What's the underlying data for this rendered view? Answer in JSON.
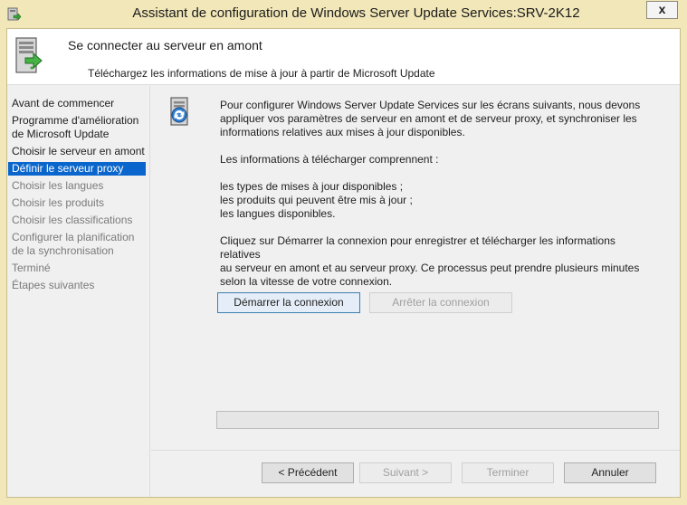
{
  "window": {
    "title": "Assistant de configuration de Windows Server Update Services:SRV-2K12",
    "close_label": "x"
  },
  "header": {
    "title": "Se connecter au serveur en amont",
    "subtitle": "Téléchargez les informations de mise à jour à partir de Microsoft Update"
  },
  "sidebar": {
    "items": [
      {
        "label": "Avant de commencer",
        "state": "normal"
      },
      {
        "label": "Programme d'amélioration de Microsoft Update",
        "state": "normal"
      },
      {
        "label": "Choisir le serveur en amont",
        "state": "normal"
      },
      {
        "label": "Définir le serveur proxy",
        "state": "active"
      },
      {
        "label": "Choisir les langues",
        "state": "muted"
      },
      {
        "label": "Choisir les produits",
        "state": "muted"
      },
      {
        "label": "Choisir les classifications",
        "state": "muted"
      },
      {
        "label": "Configurer la planification de la synchronisation",
        "state": "muted"
      },
      {
        "label": "Terminé",
        "state": "muted"
      },
      {
        "label": "Étapes suivantes",
        "state": "muted"
      }
    ]
  },
  "content": {
    "intro_line1": "Pour configurer Windows Server Update Services sur les écrans suivants, nous devons",
    "intro_line2": "appliquer vos paramètres de serveur en amont et de serveur proxy, et synchroniser les",
    "intro_line3": "informations relatives aux mises à jour disponibles.",
    "download_heading": "Les informations à télécharger comprennent :",
    "download_items": [
      "les types de mises à jour disponibles ;",
      "les produits qui peuvent être mis à jour ;",
      "les langues disponibles."
    ],
    "instruction_line1": "Cliquez sur Démarrer la connexion pour enregistrer et télécharger les informations relatives",
    "instruction_line2": "au serveur en amont et au serveur proxy. Ce processus peut prendre plusieurs minutes",
    "instruction_line3": "selon la vitesse de votre connexion.",
    "start_button": "Démarrer la connexion",
    "stop_button": "Arrêter la connexion",
    "progress_percent": 0
  },
  "footer": {
    "previous": "< Précédent",
    "next": "Suivant >",
    "finish": "Terminer",
    "cancel": "Annuler"
  },
  "colors": {
    "title_bar": "#f2e7b8",
    "selection": "#0a66cc",
    "dialog_bg": "#f0f0f0"
  }
}
